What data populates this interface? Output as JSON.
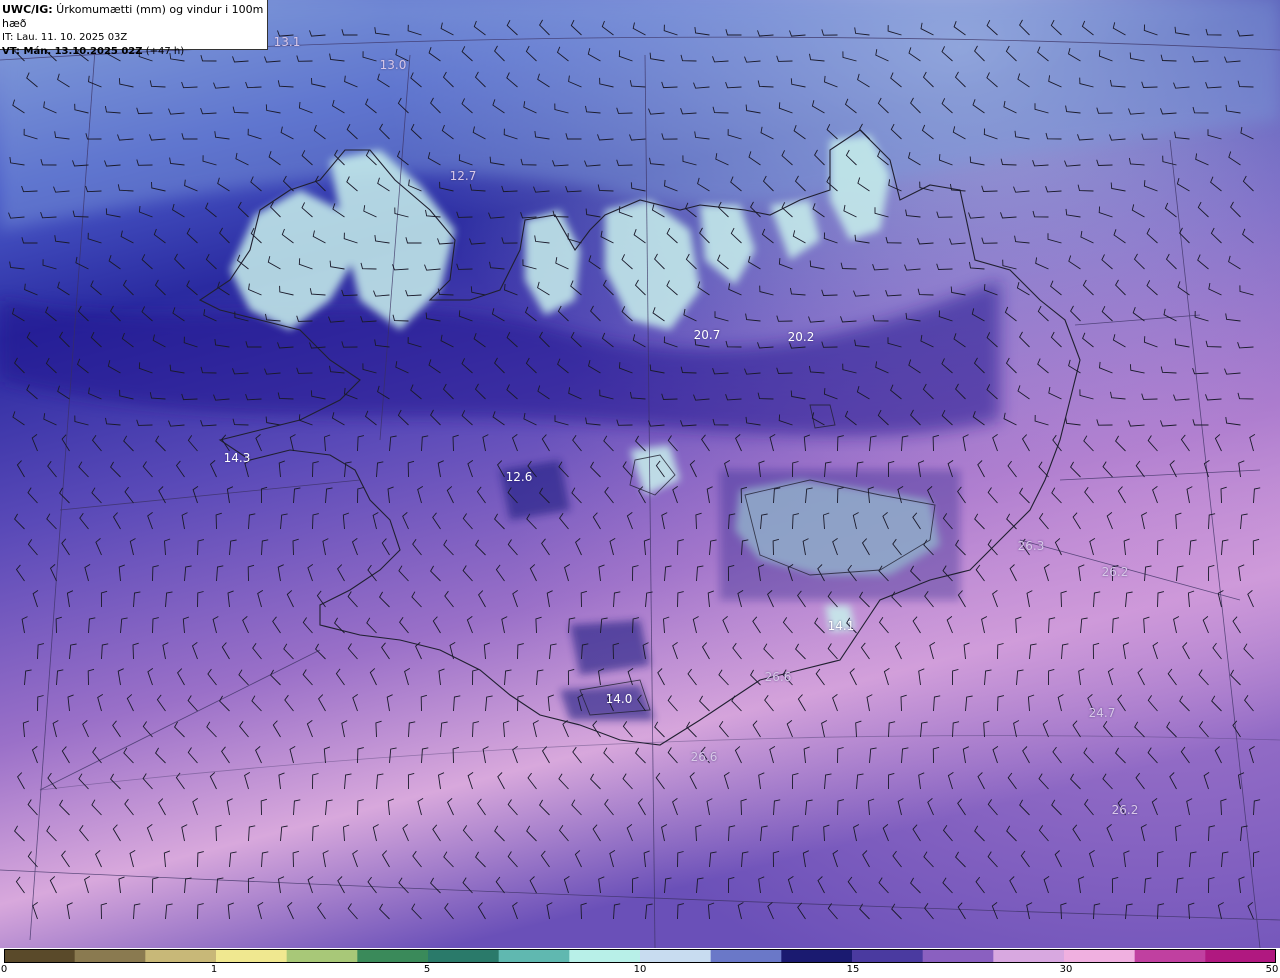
{
  "header": {
    "title_prefix": "UWC/IG:",
    "title_text": " Úrkomumætti (mm) og vindur i 100m hæð",
    "it_line": "IT: Lau. 11. 10. 2025 03Z",
    "vt_prefix": "VT: Mán. 13.10.2025 02Z",
    "vt_suffix": " (+47 h)"
  },
  "labels": [
    {
      "text": "13.1",
      "faint": true
    },
    {
      "text": "13.0",
      "faint": true
    },
    {
      "text": "12.7",
      "faint": true
    },
    {
      "text": "20.7",
      "faint": false
    },
    {
      "text": "20.2",
      "faint": false
    },
    {
      "text": "14.3",
      "faint": false
    },
    {
      "text": "12.6",
      "faint": false
    },
    {
      "text": "26.3",
      "faint": true
    },
    {
      "text": "26.2",
      "faint": true
    },
    {
      "text": "14.1",
      "faint": false
    },
    {
      "text": "26.6",
      "faint": true
    },
    {
      "text": "14.0",
      "faint": false
    },
    {
      "text": "24.7",
      "faint": true
    },
    {
      "text": "26.6",
      "faint": true
    },
    {
      "text": "26.2",
      "faint": true
    }
  ],
  "colorbar": {
    "ticks": [
      "0",
      "1",
      "5",
      "10",
      "15",
      "30",
      "50"
    ],
    "colors": [
      "#5a4a2a",
      "#8a7a50",
      "#c8b878",
      "#f0e890",
      "#a8c878",
      "#3a8a5a",
      "#2a7a6a",
      "#60b8b0",
      "#b8f0e8",
      "#c8dcf0",
      "#6a78c8",
      "#1a1a70",
      "#4a3aa0",
      "#8a60c0",
      "#d8a8e0",
      "#f0b0e0",
      "#c040a0",
      "#b01880"
    ]
  }
}
